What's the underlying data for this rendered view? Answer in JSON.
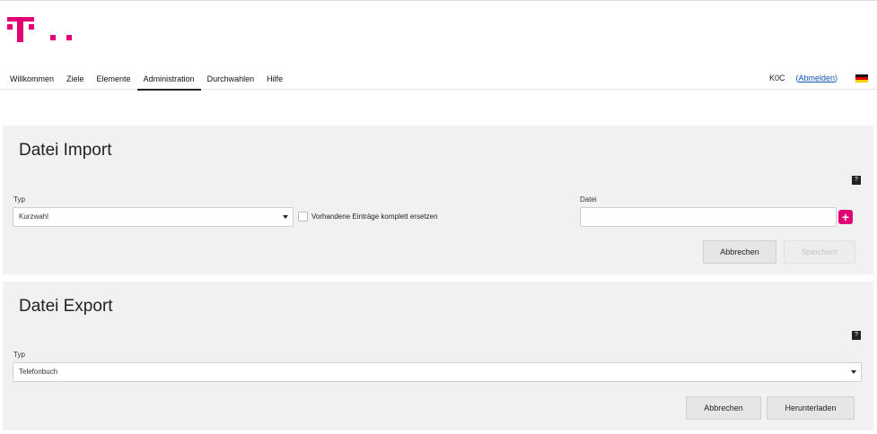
{
  "header": {
    "nav": [
      {
        "label": "Willkommen",
        "active": false
      },
      {
        "label": "Ziele",
        "active": false
      },
      {
        "label": "Elemente",
        "active": false
      },
      {
        "label": "Administration",
        "active": true
      },
      {
        "label": "Durchwahlen",
        "active": false
      },
      {
        "label": "Hilfe",
        "active": false
      }
    ],
    "user_name": "K0C",
    "logout_open": "(",
    "logout_label": "Abmelden",
    "logout_close": ")",
    "language_flag": "flag-de-icon"
  },
  "import_panel": {
    "title": "Datei Import",
    "help_label": "?",
    "type_label": "Typ",
    "type_value": "Kurzwahl",
    "replace_checkbox_label": "Vorhandene Einträge komplett ersetzen",
    "replace_checked": false,
    "file_label": "Datei",
    "file_value": "",
    "add_file_icon": "+",
    "cancel_label": "Abbrechen",
    "save_label": "Speichern"
  },
  "export_panel": {
    "title": "Datei Export",
    "help_label": "?",
    "type_label": "Typ",
    "type_value": "Telefonbuch",
    "cancel_label": "Abbrechen",
    "download_label": "Herunterladen"
  },
  "colors": {
    "brand_magenta": "#e20074",
    "panel_bg": "#f1f1f1",
    "link_blue": "#0a58b0"
  }
}
